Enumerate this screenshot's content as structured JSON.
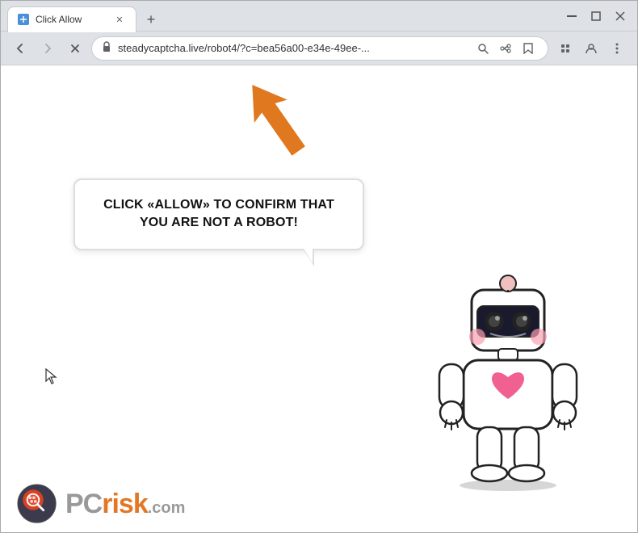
{
  "browser": {
    "tab": {
      "title": "Click Allow",
      "favicon_char": "🔒"
    },
    "new_tab_label": "+",
    "window_controls": {
      "minimize": "—",
      "maximize": "□",
      "close": "✕"
    },
    "address_bar": {
      "url": "steadycaptcha.live/robot4/?c=bea56a00-e34e-49ee-...",
      "lock_icon": "🔒"
    },
    "nav": {
      "back": "←",
      "forward": "→",
      "reload": "✕"
    }
  },
  "page": {
    "speech_bubble_text": "CLICK «ALLOW» TO CONFIRM THAT YOU ARE NOT A ROBOT!",
    "arrow_direction": "up-left",
    "robot_alt": "cartoon robot"
  },
  "watermark": {
    "pc_text": "PC",
    "risk_text": "risk",
    "com_text": ".com"
  }
}
